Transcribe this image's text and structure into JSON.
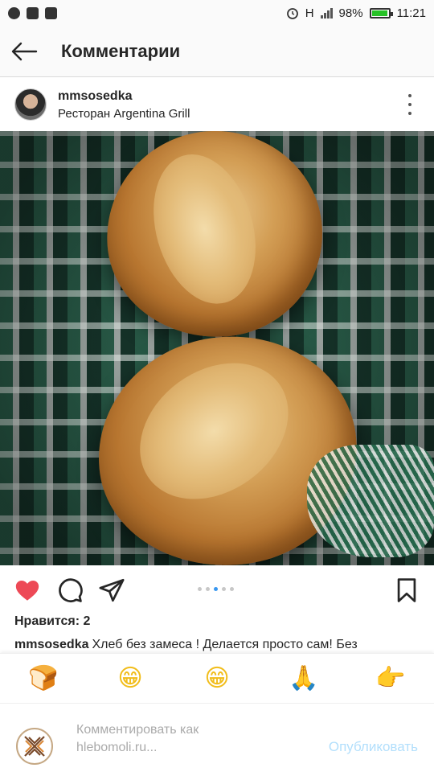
{
  "status_bar": {
    "network": "H",
    "battery": "98%",
    "battery_level": 0.98,
    "time": "11:21",
    "left_icons": [
      "viber-icon",
      "image-icon",
      "instagram-icon"
    ],
    "right_icons": [
      "alarm-icon",
      "signal-icon",
      "battery-icon"
    ]
  },
  "header": {
    "back_icon": "arrow-left-icon",
    "title": "Комментарии"
  },
  "post": {
    "username": "mmsosedka",
    "location": "Ресторан Argentina Grill",
    "more_icon": "more-vertical-icon",
    "image": "two-sourdough-loaves-on-checkered-cloth",
    "actions": {
      "like_icon": "heart-icon",
      "comment_icon": "comment-icon",
      "share_icon": "send-icon",
      "save_icon": "bookmark-icon"
    },
    "carousel": {
      "count": 5,
      "active_index": 2
    },
    "likes_text": "Нравится: 2",
    "caption_user": "mmsosedka",
    "caption_text": "Хлеб без замеса ! Делается просто сам! Без"
  },
  "emoji_bar": {
    "items": [
      {
        "name": "bread-emoji",
        "glyph": "🍞"
      },
      {
        "name": "grinning-emoji",
        "glyph": "😁"
      },
      {
        "name": "grinning-emoji-2",
        "glyph": "😁"
      },
      {
        "name": "praying-hands-emoji",
        "glyph": "🙏"
      },
      {
        "name": "pointing-hand-emoji",
        "glyph": "👉"
      }
    ]
  },
  "composer": {
    "placeholder": "Комментировать как hlebomoli.ru...",
    "publish_label": "Опубликовать"
  },
  "colors": {
    "like_red": "#ed4956",
    "publish_disabled_blue": "#b2dffc",
    "carousel_active": "#3897f0",
    "battery_green": "#27c227"
  }
}
